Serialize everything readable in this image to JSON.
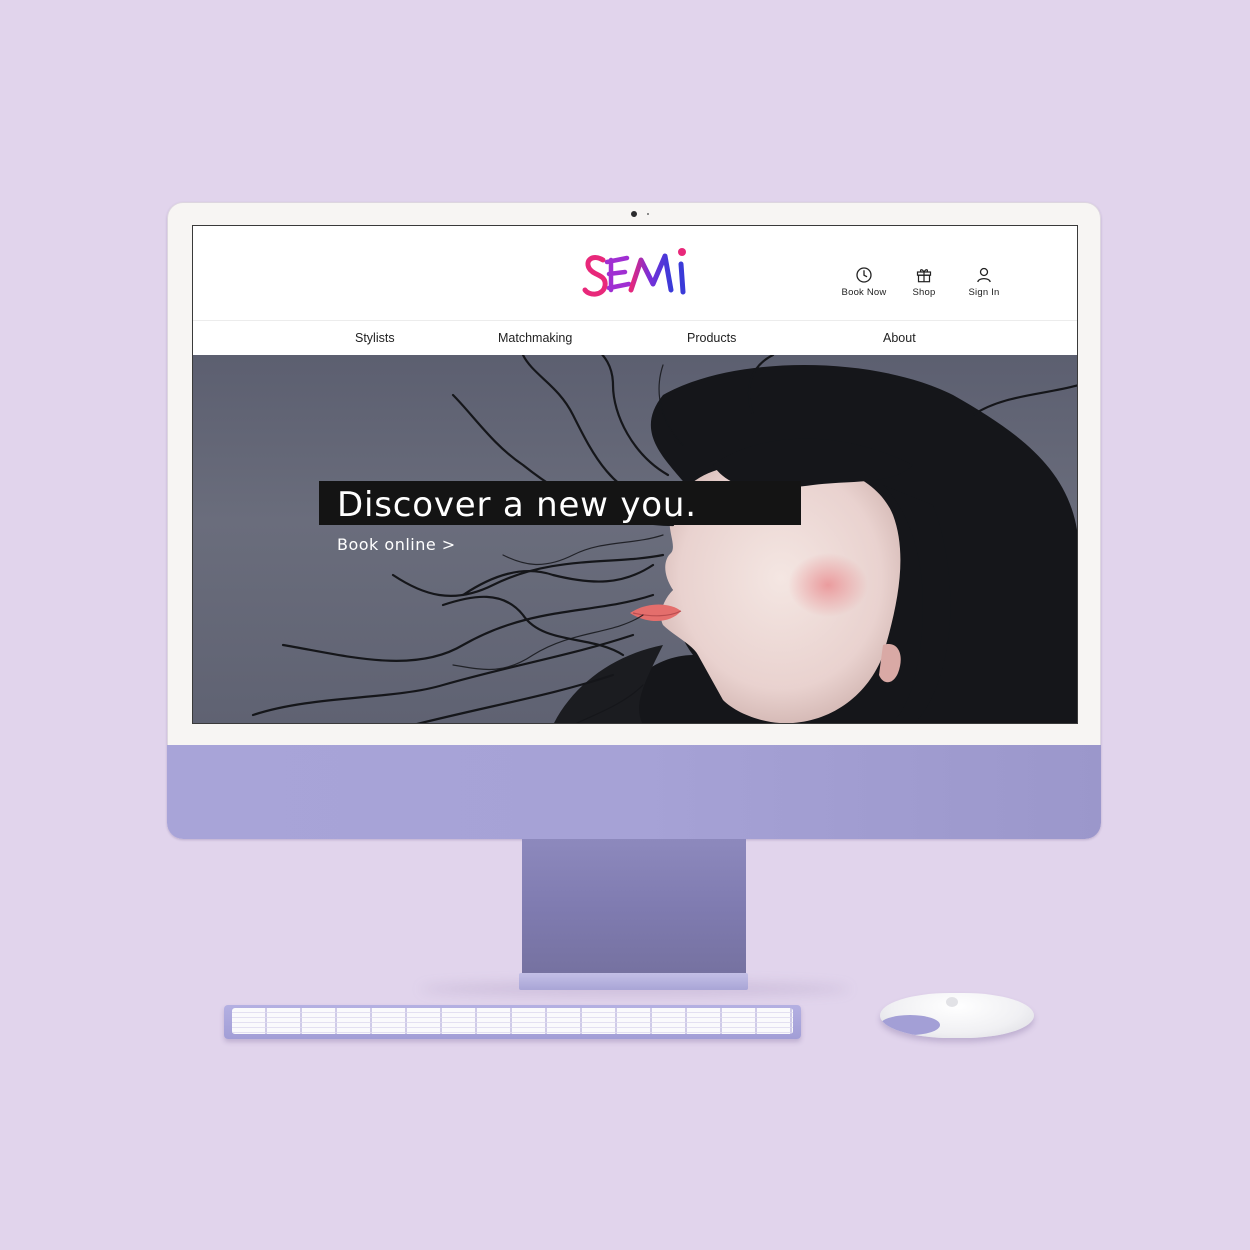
{
  "site": {
    "logo_text": "SEMI",
    "header_actions": [
      {
        "label": "Book Now",
        "icon": "clock-icon"
      },
      {
        "label": "Shop",
        "icon": "gift-icon"
      },
      {
        "label": "Sign In",
        "icon": "user-icon"
      }
    ],
    "nav": [
      {
        "label": "Stylists"
      },
      {
        "label": "Matchmaking"
      },
      {
        "label": "Products"
      },
      {
        "label": "About"
      }
    ],
    "hero": {
      "title": "Discover a new you.",
      "cta": "Book online >"
    }
  },
  "colors": {
    "background": "#e1d4ec",
    "device_purple": "#a6a2d6",
    "logo_pink": "#e8287a",
    "logo_blue": "#3a3ad8",
    "logo_purple": "#8a2bd6",
    "hero_title_bg": "#141414"
  }
}
